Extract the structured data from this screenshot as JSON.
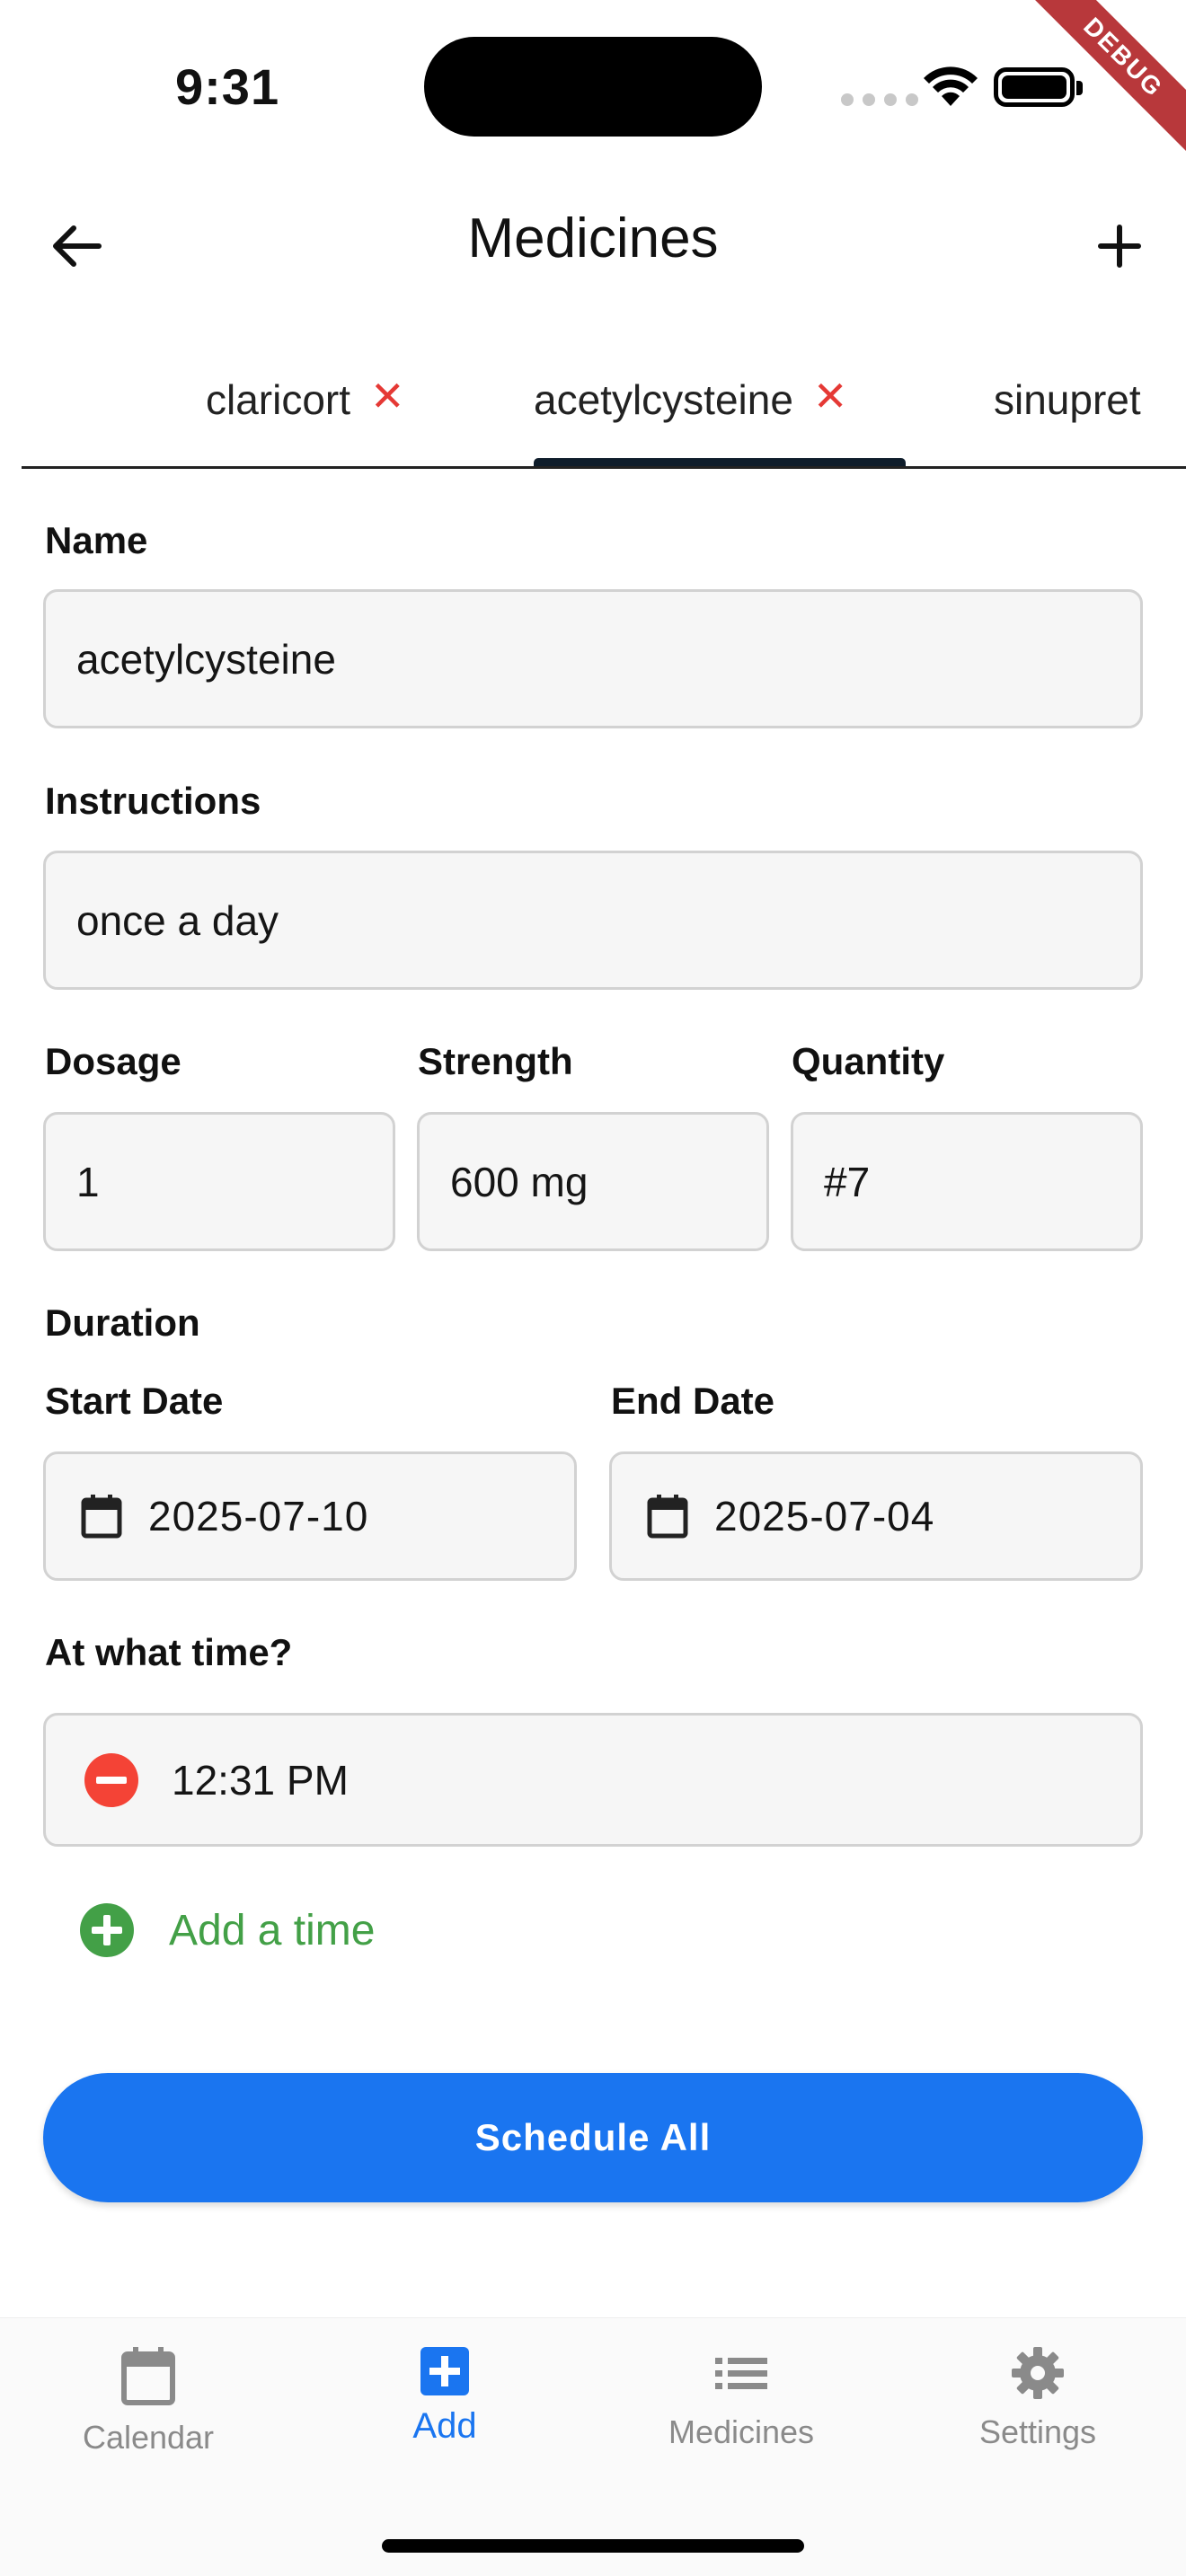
{
  "status_bar": {
    "time": "9:31",
    "debug_label": "DEBUG"
  },
  "appbar": {
    "title": "Medicines",
    "back_icon": "arrow-left-icon",
    "add_icon": "plus-icon"
  },
  "tabs": [
    {
      "label": "claricort",
      "closable": true,
      "selected": false
    },
    {
      "label": "acetylcysteine",
      "closable": true,
      "selected": true
    },
    {
      "label": "sinupret",
      "closable": false,
      "selected": false
    }
  ],
  "tab_close_glyph": "✕",
  "form": {
    "name": {
      "label": "Name",
      "value": "acetylcysteine"
    },
    "instructions": {
      "label": "Instructions",
      "value": "once a day"
    },
    "dosage": {
      "label": "Dosage",
      "value": "1"
    },
    "strength": {
      "label": "Strength",
      "value": "600 mg"
    },
    "quantity": {
      "label": "Quantity",
      "value": "#7"
    },
    "duration_label": "Duration",
    "start_date": {
      "label": "Start Date",
      "value": "2025-07-10"
    },
    "end_date": {
      "label": "End Date",
      "value": "2025-07-04"
    },
    "time_label": "At what time?",
    "times": [
      "12:31 PM"
    ],
    "add_time_label": "Add a time"
  },
  "schedule_button": "Schedule All",
  "bottom_nav": [
    {
      "label": "Calendar",
      "icon": "calendar-icon",
      "active": false
    },
    {
      "label": "Add",
      "icon": "add-box-icon",
      "active": true
    },
    {
      "label": "Medicines",
      "icon": "list-icon",
      "active": false
    },
    {
      "label": "Settings",
      "icon": "gear-icon",
      "active": false
    }
  ],
  "colors": {
    "accent": "#1a75f0",
    "remove": "#f44336",
    "add": "#43a047",
    "debug": "#b8383b"
  }
}
